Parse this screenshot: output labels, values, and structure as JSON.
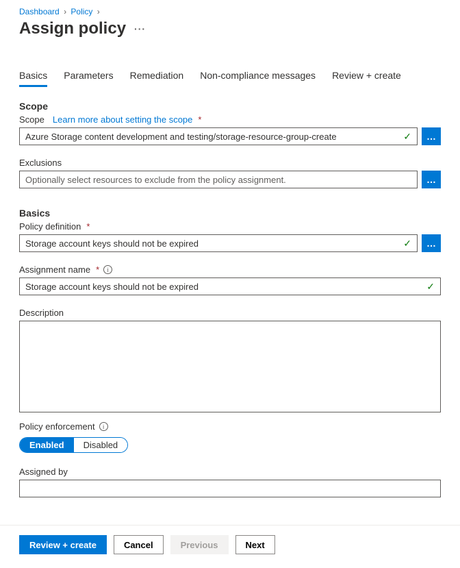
{
  "breadcrumb": {
    "items": [
      "Dashboard",
      "Policy"
    ]
  },
  "title": "Assign policy",
  "tabs": {
    "t0": "Basics",
    "t1": "Parameters",
    "t2": "Remediation",
    "t3": "Non-compliance messages",
    "t4": "Review + create"
  },
  "scope": {
    "heading": "Scope",
    "label": "Scope",
    "learn_link": "Learn more about setting the scope",
    "value": "Azure Storage content development and testing/storage-resource-group-create",
    "exclusions_label": "Exclusions",
    "exclusions_placeholder": "Optionally select resources to exclude from the policy assignment."
  },
  "basics": {
    "heading": "Basics",
    "policy_def_label": "Policy definition",
    "policy_def_value": "Storage account keys should not be expired",
    "assignment_label": "Assignment name",
    "assignment_value": "Storage account keys should not be expired",
    "description_label": "Description",
    "enforcement_label": "Policy enforcement",
    "enforcement_enabled": "Enabled",
    "enforcement_disabled": "Disabled",
    "assigned_by_label": "Assigned by"
  },
  "footer": {
    "review": "Review + create",
    "cancel": "Cancel",
    "previous": "Previous",
    "next": "Next"
  }
}
